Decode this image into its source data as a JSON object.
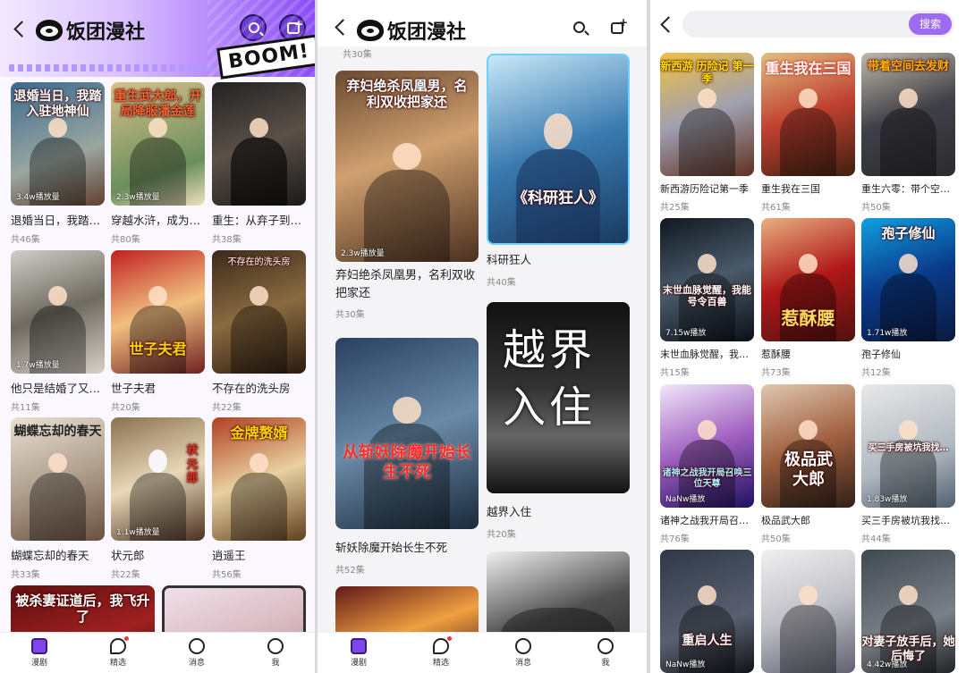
{
  "app": {
    "name": "饭团漫社",
    "boom": "BOOM!"
  },
  "search": {
    "button_label": "搜索",
    "placeholder": ""
  },
  "colors": {
    "accent": "#7e46e8",
    "search_button": "#9d6bf2",
    "notify_dot": "#e23b3b"
  },
  "panel1": {
    "cards": [
      {
        "cover_title": "退婚当日，我踏入驻地神仙",
        "name": "退婚当日，我踏…",
        "views": "3.4w播放量",
        "episodes": "共46集"
      },
      {
        "cover_title": "重生武大郎，开局降服潘金莲",
        "name": "穿越水浒，成为…",
        "views": "2.3w播放量",
        "episodes": "共80集"
      },
      {
        "cover_title": "",
        "name": "重生：从弃子到…",
        "views": "",
        "episodes": "共38集"
      },
      {
        "cover_title": "",
        "name": "他只是结婚了又…",
        "views": "1.7w播放量",
        "episodes": "共11集"
      },
      {
        "cover_title": "世子夫君",
        "name": "世子夫君",
        "views": "",
        "episodes": "共20集"
      },
      {
        "cover_title": "不存在的洗头房",
        "name": "不存在的洗头房",
        "views": "",
        "episodes": "共22集"
      },
      {
        "cover_title": "蝴蝶忘却的春天",
        "name": "蝴蝶忘却的春天",
        "views": "",
        "episodes": "共33集"
      },
      {
        "cover_title": "状元郎",
        "name": "状元郎",
        "views": "1.1w播放量",
        "episodes": "共22集"
      },
      {
        "cover_title": "金牌赘婿",
        "name": "逍遥王",
        "views": "",
        "episodes": "共56集"
      },
      {
        "cover_title": "被杀妻证道后，我飞升了",
        "name": "",
        "views": "",
        "episodes": ""
      },
      {
        "cover_title": "",
        "name": "",
        "views": "",
        "episodes": ""
      }
    ]
  },
  "panel2": {
    "top_episodes": "共30集",
    "cards": [
      {
        "cover_title": "弃妇绝杀凤凰男，名利双收把家还",
        "name": "弃妇绝杀凤凰男，名利双收把家还",
        "views": "2.3w播放量",
        "episodes": "共30集"
      },
      {
        "cover_title": "《科研狂人》",
        "name": "科研狂人",
        "views": "",
        "episodes": "共40集"
      },
      {
        "cover_title": "从斩妖除魔开始长生不死",
        "name": "斩妖除魔开始长生不死",
        "views": "",
        "episodes": "共52集"
      },
      {
        "cover_title": "越界入住",
        "name": "越界入住",
        "views": "",
        "episodes": "共20集"
      },
      {
        "cover_title": "",
        "name": "",
        "views": "",
        "episodes": ""
      },
      {
        "cover_title": "",
        "name": "",
        "views": "",
        "episodes": ""
      }
    ]
  },
  "panel3": {
    "cards": [
      {
        "cover_title": "新西游 历险记 第一季",
        "name": "新西游历险记第一季",
        "views": "",
        "episodes": "共25集"
      },
      {
        "cover_title": "重生我在三国",
        "name": "重生我在三国",
        "views": "",
        "episodes": "共61集"
      },
      {
        "cover_title": "带着空间去发财",
        "name": "重生六零：带个空…",
        "views": "",
        "episodes": "共50集"
      },
      {
        "cover_title": "末世血脉觉醒，我能号令百兽",
        "name": "末世血脉觉醒，我…",
        "views": "7.15w播放",
        "episodes": "共15集"
      },
      {
        "cover_title": "惹酥腰",
        "name": "惹酥腰",
        "views": "",
        "episodes": "共73集"
      },
      {
        "cover_title": "孢子修仙",
        "name": "孢子修仙",
        "views": "1.71w播放",
        "episodes": "共12集"
      },
      {
        "cover_title": "诸神之战我开局召唤三位天尊",
        "name": "诸神之战我开局召…",
        "views": "NaNw播放",
        "episodes": "共76集"
      },
      {
        "cover_title": "极品武大郎",
        "name": "极品武大郎",
        "views": "",
        "episodes": "共50集"
      },
      {
        "cover_title": "买三手房被坑我找…",
        "name": "买三手房被坑我找…",
        "views": "1.83w播放",
        "episodes": "共44集"
      },
      {
        "cover_title": "重启人生",
        "name": "",
        "views": "NaNw播放",
        "episodes": ""
      },
      {
        "cover_title": "",
        "name": "",
        "views": "",
        "episodes": ""
      },
      {
        "cover_title": "对妻子放手后，她后悔了",
        "name": "",
        "views": "4.42w播放",
        "episodes": ""
      }
    ]
  },
  "tabs": [
    {
      "label": "漫剧"
    },
    {
      "label": "精选"
    },
    {
      "label": "消息"
    },
    {
      "label": "我"
    }
  ]
}
